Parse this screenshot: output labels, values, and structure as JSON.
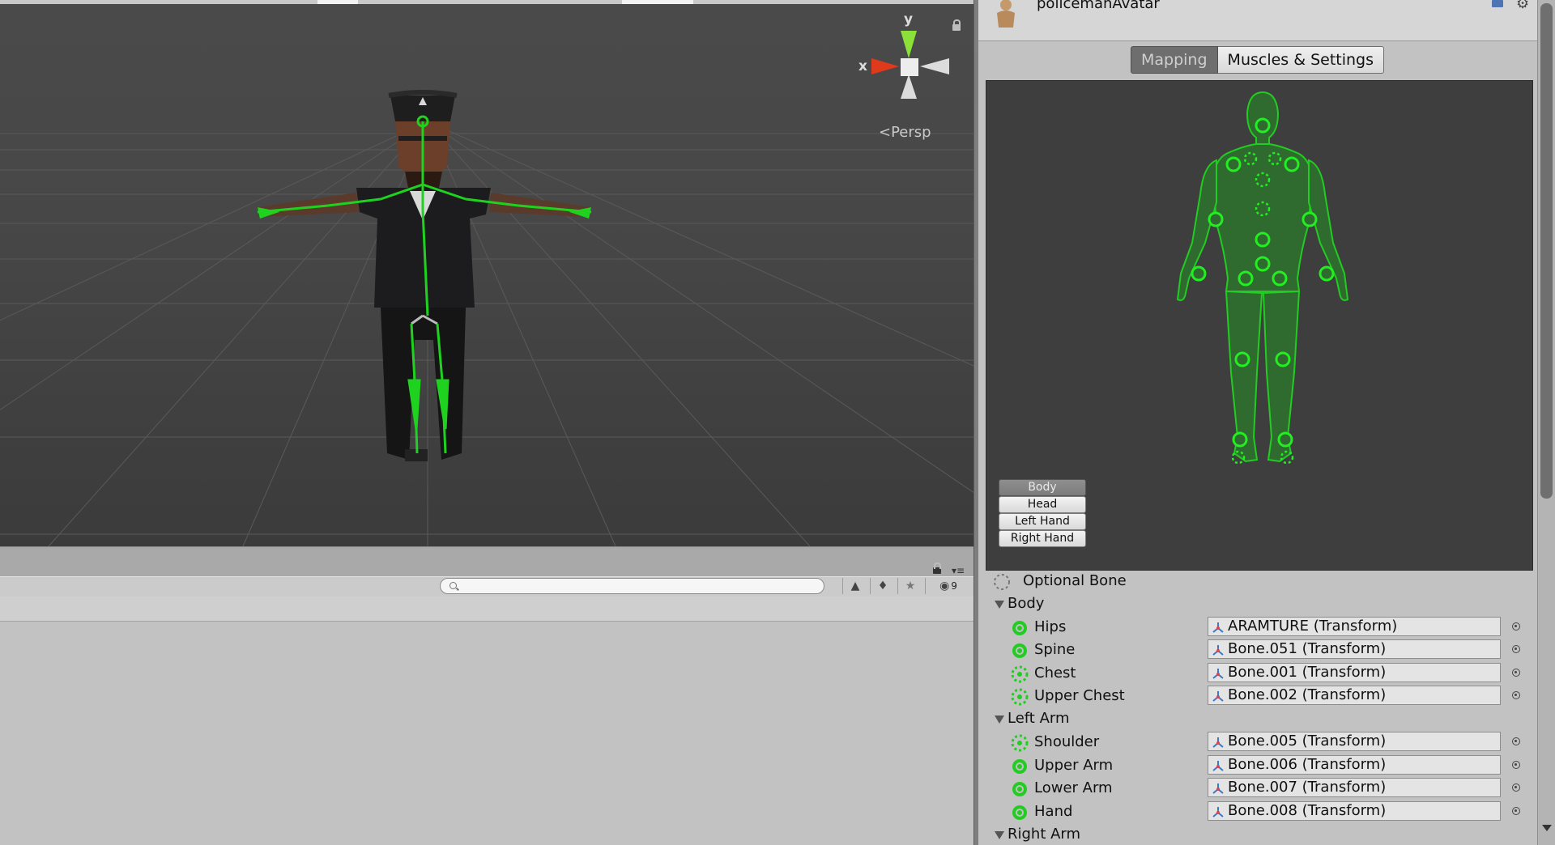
{
  "scene": {
    "axis_x_label": "x",
    "axis_y_label": "y",
    "projection_label": "Persp"
  },
  "hierarchy": {
    "search_placeholder": "",
    "hidden_count": "9"
  },
  "inspector": {
    "asset_name": "policemanAvatar",
    "tabs": [
      "Mapping",
      "Muscles & Settings"
    ],
    "active_tab": "Mapping",
    "body_part_buttons": [
      "Body",
      "Head",
      "Left Hand",
      "Right Hand"
    ],
    "active_body_part": "Body",
    "optional_bone_label": "Optional Bone",
    "groups": [
      {
        "name": "Body",
        "bones": [
          {
            "name": "Hips",
            "value": "ARAMTURE (Transform)",
            "optional": false
          },
          {
            "name": "Spine",
            "value": "Bone.051 (Transform)",
            "optional": false
          },
          {
            "name": "Chest",
            "value": "Bone.001 (Transform)",
            "optional": true
          },
          {
            "name": "Upper Chest",
            "value": "Bone.002 (Transform)",
            "optional": true
          }
        ]
      },
      {
        "name": "Left Arm",
        "bones": [
          {
            "name": "Shoulder",
            "value": "Bone.005 (Transform)",
            "optional": true
          },
          {
            "name": "Upper Arm",
            "value": "Bone.006 (Transform)",
            "optional": false
          },
          {
            "name": "Lower Arm",
            "value": "Bone.007 (Transform)",
            "optional": false
          },
          {
            "name": "Hand",
            "value": "Bone.008 (Transform)",
            "optional": false
          }
        ]
      },
      {
        "name": "Right Arm",
        "bones": []
      }
    ]
  },
  "colors": {
    "bone_green": "#22cc22",
    "axis_x": "#e03a1c",
    "axis_y": "#8be03a",
    "body_fill": "#2f6b2f"
  }
}
